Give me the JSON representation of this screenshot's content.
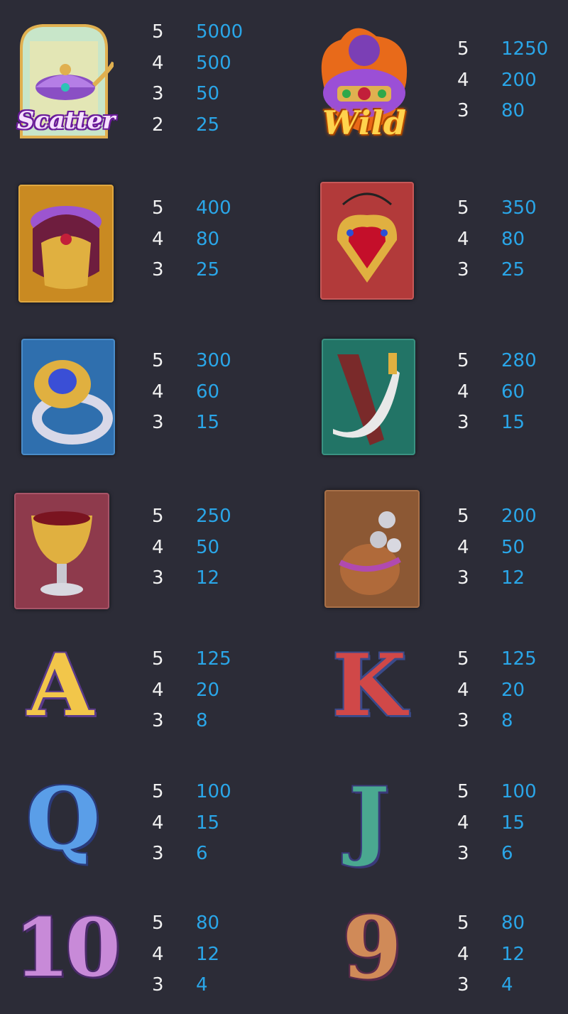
{
  "symbols": [
    {
      "id": "scatter",
      "label": "Scatter",
      "pays": [
        {
          "count": "5",
          "value": "5000"
        },
        {
          "count": "4",
          "value": "500"
        },
        {
          "count": "3",
          "value": "50"
        },
        {
          "count": "2",
          "value": "25"
        }
      ]
    },
    {
      "id": "wild",
      "label": "Wild",
      "pays": [
        {
          "count": "5",
          "value": "1250"
        },
        {
          "count": "4",
          "value": "200"
        },
        {
          "count": "3",
          "value": "80"
        }
      ]
    },
    {
      "id": "helmet",
      "pays": [
        {
          "count": "5",
          "value": "400"
        },
        {
          "count": "4",
          "value": "80"
        },
        {
          "count": "3",
          "value": "25"
        }
      ]
    },
    {
      "id": "amulet",
      "pays": [
        {
          "count": "5",
          "value": "350"
        },
        {
          "count": "4",
          "value": "80"
        },
        {
          "count": "3",
          "value": "25"
        }
      ]
    },
    {
      "id": "ring",
      "pays": [
        {
          "count": "5",
          "value": "300"
        },
        {
          "count": "4",
          "value": "60"
        },
        {
          "count": "3",
          "value": "15"
        }
      ]
    },
    {
      "id": "swords",
      "pays": [
        {
          "count": "5",
          "value": "280"
        },
        {
          "count": "4",
          "value": "60"
        },
        {
          "count": "3",
          "value": "15"
        }
      ]
    },
    {
      "id": "goblet",
      "pays": [
        {
          "count": "5",
          "value": "250"
        },
        {
          "count": "4",
          "value": "50"
        },
        {
          "count": "3",
          "value": "12"
        }
      ]
    },
    {
      "id": "coin-bag",
      "pays": [
        {
          "count": "5",
          "value": "200"
        },
        {
          "count": "4",
          "value": "50"
        },
        {
          "count": "3",
          "value": "12"
        }
      ]
    },
    {
      "id": "A",
      "label": "A",
      "pays": [
        {
          "count": "5",
          "value": "125"
        },
        {
          "count": "4",
          "value": "20"
        },
        {
          "count": "3",
          "value": "8"
        }
      ]
    },
    {
      "id": "K",
      "label": "K",
      "pays": [
        {
          "count": "5",
          "value": "125"
        },
        {
          "count": "4",
          "value": "20"
        },
        {
          "count": "3",
          "value": "8"
        }
      ]
    },
    {
      "id": "Q",
      "label": "Q",
      "pays": [
        {
          "count": "5",
          "value": "100"
        },
        {
          "count": "4",
          "value": "15"
        },
        {
          "count": "3",
          "value": "6"
        }
      ]
    },
    {
      "id": "J",
      "label": "J",
      "pays": [
        {
          "count": "5",
          "value": "100"
        },
        {
          "count": "4",
          "value": "15"
        },
        {
          "count": "3",
          "value": "6"
        }
      ]
    },
    {
      "id": "10",
      "label": "10",
      "pays": [
        {
          "count": "5",
          "value": "80"
        },
        {
          "count": "4",
          "value": "12"
        },
        {
          "count": "3",
          "value": "4"
        }
      ]
    },
    {
      "id": "9",
      "label": "9",
      "pays": [
        {
          "count": "5",
          "value": "80"
        },
        {
          "count": "4",
          "value": "12"
        },
        {
          "count": "3",
          "value": "4"
        }
      ]
    }
  ],
  "colors": {
    "background": "#2c2c37",
    "count_text": "#f2f2f2",
    "value_text": "#2aa6e8"
  }
}
